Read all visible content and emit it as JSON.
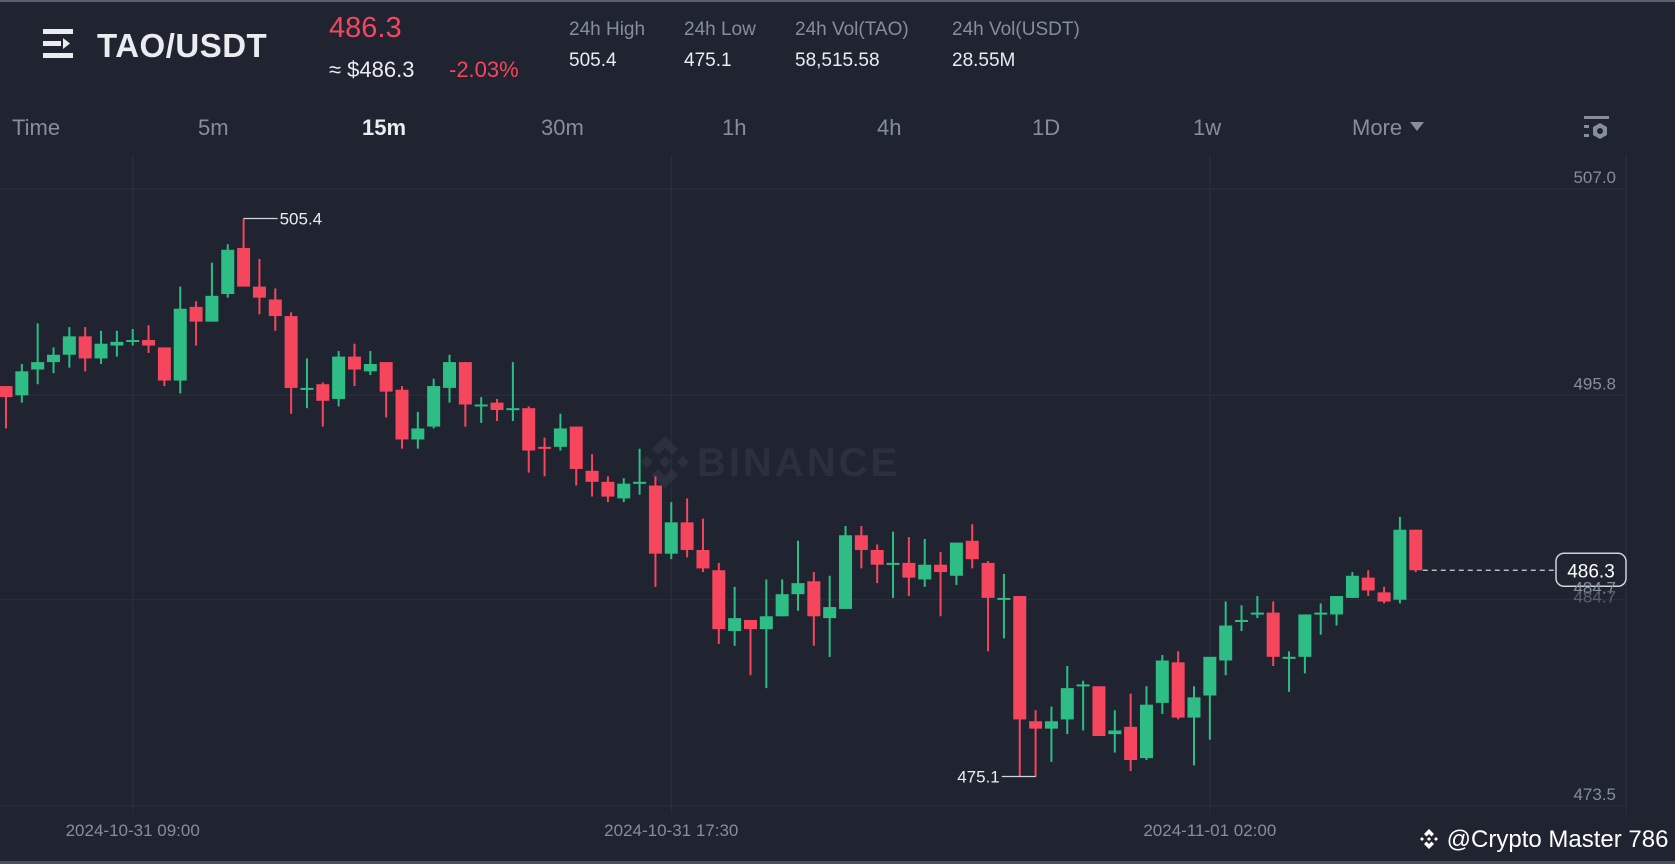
{
  "header": {
    "pair": "TAO/USDT",
    "last_price": "486.3",
    "approx_usd": "≈ $486.3",
    "change_pct": "-2.03%",
    "stats": [
      {
        "label": "24h High",
        "value": "505.4"
      },
      {
        "label": "24h Low",
        "value": "475.1"
      },
      {
        "label": "24h Vol(TAO)",
        "value": "58,515.58"
      },
      {
        "label": "24h Vol(USDT)",
        "value": "28.55M"
      }
    ]
  },
  "intervals": {
    "tabs": [
      "Time",
      "5m",
      "15m",
      "30m",
      "1h",
      "4h",
      "1D",
      "1w"
    ],
    "active": "15m",
    "more_label": "More"
  },
  "icons": {
    "menu": "menu-arrow-icon",
    "settings": "chart-settings-icon",
    "brand": "binance-diamond-icon"
  },
  "colors": {
    "up": "#2ebd85",
    "down": "#f6465d",
    "background": "#1f2430",
    "grid": "#2b313c",
    "axis_text": "#848e9c"
  },
  "watermark": {
    "logo_text": "BINANCE",
    "author": "@Crypto Master 786"
  },
  "chart_data": {
    "type": "candlestick",
    "interval": "15m",
    "ylim": [
      473.5,
      507.0
    ],
    "grid": true,
    "y_ticks": [
      "507.0",
      "495.8",
      "484.7",
      "473.5"
    ],
    "x_ticks": [
      {
        "label": "2024-10-31 09:00",
        "at_index": 8
      },
      {
        "label": "2024-10-31 17:30",
        "at_index": 42
      },
      {
        "label": "2024-11-01 02:00",
        "at_index": 76
      }
    ],
    "annotations": {
      "high": {
        "label": "505.4",
        "at_index": 15
      },
      "low": {
        "label": "475.1",
        "at_index": 64
      },
      "last": {
        "label": "486.3",
        "value": 486.3
      },
      "hidden_tick": "484.7"
    },
    "ohlc": [
      [
        496.3,
        496.3,
        494.0,
        495.7
      ],
      [
        495.8,
        497.5,
        495.4,
        497.1
      ],
      [
        497.2,
        499.7,
        496.4,
        497.6
      ],
      [
        497.6,
        498.4,
        497.0,
        498.0
      ],
      [
        498.0,
        499.5,
        497.3,
        499.0
      ],
      [
        499.0,
        499.5,
        497.1,
        497.8
      ],
      [
        497.8,
        499.3,
        497.5,
        498.6
      ],
      [
        498.5,
        499.3,
        497.9,
        498.7
      ],
      [
        498.8,
        499.4,
        498.5,
        498.8
      ],
      [
        498.8,
        499.6,
        498.1,
        498.5
      ],
      [
        498.4,
        498.4,
        496.3,
        496.6
      ],
      [
        496.6,
        501.7,
        495.9,
        500.5
      ],
      [
        500.6,
        500.9,
        498.5,
        499.8
      ],
      [
        499.8,
        503.0,
        499.8,
        501.2
      ],
      [
        501.3,
        504.0,
        501.1,
        503.7
      ],
      [
        503.8,
        505.4,
        501.7,
        501.7
      ],
      [
        501.7,
        503.2,
        500.2,
        501.1
      ],
      [
        501.0,
        501.6,
        499.3,
        500.1
      ],
      [
        500.1,
        500.3,
        494.8,
        496.2
      ],
      [
        496.2,
        497.8,
        495.1,
        496.2
      ],
      [
        496.4,
        496.5,
        494.1,
        495.5
      ],
      [
        495.6,
        498.2,
        495.2,
        497.9
      ],
      [
        497.9,
        498.6,
        496.3,
        497.2
      ],
      [
        497.1,
        498.2,
        496.9,
        497.5
      ],
      [
        497.6,
        497.6,
        494.6,
        496.0
      ],
      [
        496.1,
        496.3,
        492.9,
        493.4
      ],
      [
        493.4,
        494.9,
        492.9,
        494.0
      ],
      [
        494.1,
        496.7,
        494.0,
        496.3
      ],
      [
        496.2,
        498.0,
        495.4,
        497.6
      ],
      [
        497.6,
        497.6,
        494.1,
        495.3
      ],
      [
        495.3,
        495.7,
        494.3,
        495.3
      ],
      [
        495.4,
        495.6,
        494.4,
        495.0
      ],
      [
        495.1,
        497.6,
        494.4,
        495.1
      ],
      [
        495.1,
        495.2,
        491.6,
        492.8
      ],
      [
        493.0,
        493.5,
        491.4,
        492.9
      ],
      [
        493.0,
        494.8,
        492.8,
        494.0
      ],
      [
        494.1,
        494.1,
        490.9,
        491.8
      ],
      [
        491.7,
        492.6,
        490.3,
        491.1
      ],
      [
        491.1,
        491.4,
        490.0,
        490.3
      ],
      [
        490.2,
        491.3,
        490.0,
        491.0
      ],
      [
        491.1,
        492.9,
        490.4,
        491.1
      ],
      [
        490.9,
        491.4,
        485.4,
        487.2
      ],
      [
        487.2,
        490.0,
        486.9,
        488.9
      ],
      [
        488.9,
        490.2,
        487.0,
        487.4
      ],
      [
        487.4,
        489.1,
        486.2,
        486.4
      ],
      [
        486.3,
        486.7,
        482.3,
        483.1
      ],
      [
        483.0,
        485.4,
        482.2,
        483.7
      ],
      [
        483.6,
        483.6,
        480.6,
        483.1
      ],
      [
        483.1,
        485.8,
        479.9,
        483.8
      ],
      [
        483.8,
        485.8,
        483.8,
        485.0
      ],
      [
        485.0,
        487.9,
        484.1,
        485.6
      ],
      [
        485.7,
        486.2,
        482.2,
        483.8
      ],
      [
        483.7,
        486.0,
        481.6,
        484.3
      ],
      [
        484.2,
        488.7,
        484.2,
        488.2
      ],
      [
        488.2,
        488.7,
        486.4,
        487.4
      ],
      [
        487.4,
        487.7,
        485.6,
        486.6
      ],
      [
        486.7,
        488.4,
        484.8,
        486.7
      ],
      [
        486.7,
        488.1,
        484.9,
        485.9
      ],
      [
        485.8,
        488.0,
        485.4,
        486.6
      ],
      [
        486.6,
        487.3,
        483.8,
        486.2
      ],
      [
        486.0,
        487.8,
        485.5,
        487.8
      ],
      [
        487.9,
        488.8,
        486.4,
        486.9
      ],
      [
        486.7,
        486.8,
        481.9,
        484.8
      ],
      [
        484.8,
        486.1,
        482.6,
        484.8
      ],
      [
        484.9,
        484.9,
        475.1,
        478.2
      ],
      [
        478.1,
        478.7,
        475.1,
        477.7
      ],
      [
        477.7,
        478.9,
        475.9,
        478.1
      ],
      [
        478.2,
        481.1,
        477.4,
        479.9
      ],
      [
        480.1,
        480.3,
        477.6,
        480.1
      ],
      [
        480.0,
        480.0,
        477.3,
        477.3
      ],
      [
        477.4,
        478.7,
        476.4,
        477.6
      ],
      [
        477.8,
        479.6,
        475.4,
        476.0
      ],
      [
        476.1,
        480.0,
        476.0,
        479.0
      ],
      [
        479.1,
        481.7,
        478.5,
        481.4
      ],
      [
        481.3,
        481.9,
        478.2,
        478.3
      ],
      [
        478.3,
        480.0,
        475.7,
        479.4
      ],
      [
        479.5,
        481.6,
        477.1,
        481.6
      ],
      [
        481.4,
        484.6,
        480.6,
        483.3
      ],
      [
        483.6,
        484.4,
        483.0,
        483.6
      ],
      [
        484.0,
        484.9,
        483.7,
        484.0
      ],
      [
        484.0,
        484.6,
        481.1,
        481.6
      ],
      [
        481.6,
        481.9,
        479.7,
        481.6
      ],
      [
        481.6,
        483.9,
        480.7,
        483.9
      ],
      [
        484.0,
        484.5,
        482.8,
        484.0
      ],
      [
        483.9,
        484.9,
        483.3,
        484.9
      ],
      [
        484.8,
        486.2,
        484.8,
        486.0
      ],
      [
        485.9,
        486.3,
        484.9,
        485.2
      ],
      [
        485.1,
        485.4,
        484.5,
        484.6
      ],
      [
        484.7,
        489.2,
        484.5,
        488.5
      ],
      [
        488.5,
        488.5,
        486.2,
        486.3
      ]
    ]
  }
}
